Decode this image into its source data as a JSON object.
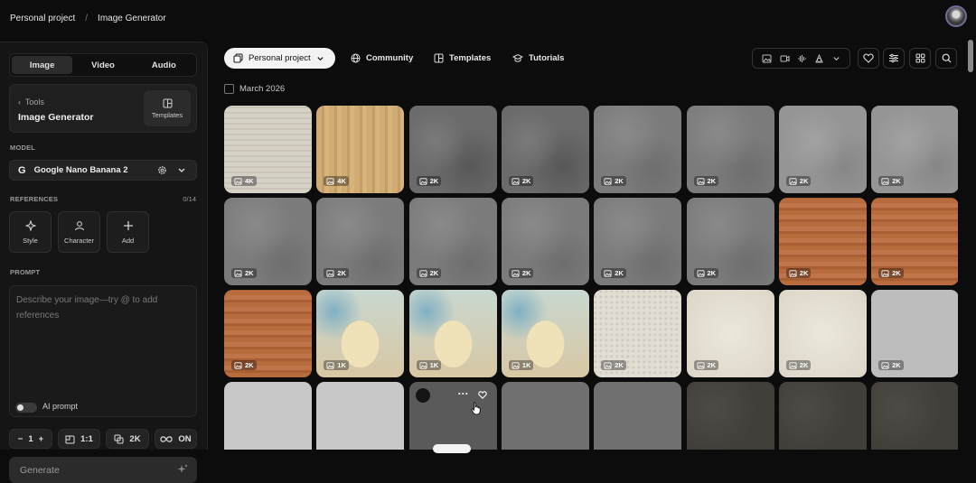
{
  "breadcrumb": {
    "project": "Personal project",
    "separator": "/",
    "page": "Image Generator"
  },
  "sidebar": {
    "tabs": [
      {
        "label": "Image",
        "active": true
      },
      {
        "label": "Video",
        "active": false
      },
      {
        "label": "Audio",
        "active": false
      }
    ],
    "tool_back": "Tools",
    "tool_name": "Image Generator",
    "templates_label": "Templates",
    "model_section": "MODEL",
    "model_name": "Google Nano Banana 2",
    "references_section": "REFERENCES",
    "references_count": "0/14",
    "reference_buttons": [
      {
        "label": "Style",
        "icon": "style-icon"
      },
      {
        "label": "Character",
        "icon": "character-icon"
      },
      {
        "label": "Add",
        "icon": "plus-icon"
      }
    ],
    "prompt_section": "PROMPT",
    "prompt_placeholder": "Describe your image—try @ to add references",
    "ai_prompt_label": "AI prompt",
    "ai_prompt_enabled": false,
    "quantity": "1",
    "aspect_ratio": "1:1",
    "resolution": "2K",
    "loop_state": "ON",
    "generate_label": "Generate"
  },
  "toolbar": {
    "project_pill": "Personal project",
    "links": [
      "Community",
      "Templates",
      "Tutorials"
    ]
  },
  "gallery": {
    "date_header": "March 2026",
    "tiles": [
      {
        "kind": "fabric",
        "res": "4K"
      },
      {
        "kind": "wood-light",
        "res": "4K"
      },
      {
        "kind": "concrete-dark",
        "res": "2K"
      },
      {
        "kind": "concrete-dark",
        "res": "2K"
      },
      {
        "kind": "concrete",
        "res": "2K"
      },
      {
        "kind": "concrete",
        "res": "2K"
      },
      {
        "kind": "concrete-light",
        "res": "2K"
      },
      {
        "kind": "concrete-light",
        "res": "2K"
      },
      {
        "kind": "concrete",
        "res": "2K"
      },
      {
        "kind": "concrete",
        "res": "2K"
      },
      {
        "kind": "concrete",
        "res": "2K"
      },
      {
        "kind": "concrete",
        "res": "2K"
      },
      {
        "kind": "concrete",
        "res": "2K"
      },
      {
        "kind": "concrete",
        "res": "2K"
      },
      {
        "kind": "wood-orange",
        "res": "2K"
      },
      {
        "kind": "wood-orange",
        "res": "2K"
      },
      {
        "kind": "wood-orange",
        "res": "2K"
      },
      {
        "kind": "illustration",
        "res": "1K"
      },
      {
        "kind": "illustration",
        "res": "1K"
      },
      {
        "kind": "illustration",
        "res": "1K"
      },
      {
        "kind": "terrazzo",
        "res": "2K"
      },
      {
        "kind": "plaster",
        "res": "2K"
      },
      {
        "kind": "plaster",
        "res": "2K"
      },
      {
        "kind": "grey",
        "res": "2K"
      },
      {
        "kind": "grey-light",
        "res": ""
      },
      {
        "kind": "grey-light",
        "res": ""
      },
      {
        "kind": "hover",
        "res": ""
      },
      {
        "kind": "grey-mid",
        "res": ""
      },
      {
        "kind": "grey-mid",
        "res": ""
      },
      {
        "kind": "asphalt",
        "res": ""
      },
      {
        "kind": "asphalt",
        "res": ""
      },
      {
        "kind": "asphalt",
        "res": ""
      }
    ]
  }
}
